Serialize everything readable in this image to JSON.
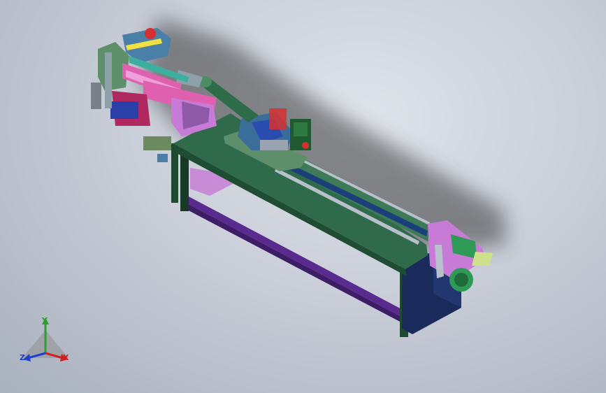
{
  "view": {
    "background_top": "#dfe3ea",
    "background_bottom": "#a9b0be"
  },
  "model": {
    "colors": {
      "table_top": "#2f6b4a",
      "table_edge": "#1f4d33",
      "frame": "#1e4a30",
      "crossbar": "#5a2b8f",
      "rail": "#1b3f7a",
      "accent_pink": "#e060b0",
      "accent_yellow": "#f0e040",
      "accent_teal": "#3bb0a0",
      "accent_red": "#d83030",
      "cabinet": "#1a2a5a"
    }
  },
  "triad": {
    "y_label": "Y",
    "z_label": "Z",
    "x_label": "X",
    "y_color": "#2aa12a",
    "z_color": "#2040d0",
    "x_color": "#d02020"
  }
}
